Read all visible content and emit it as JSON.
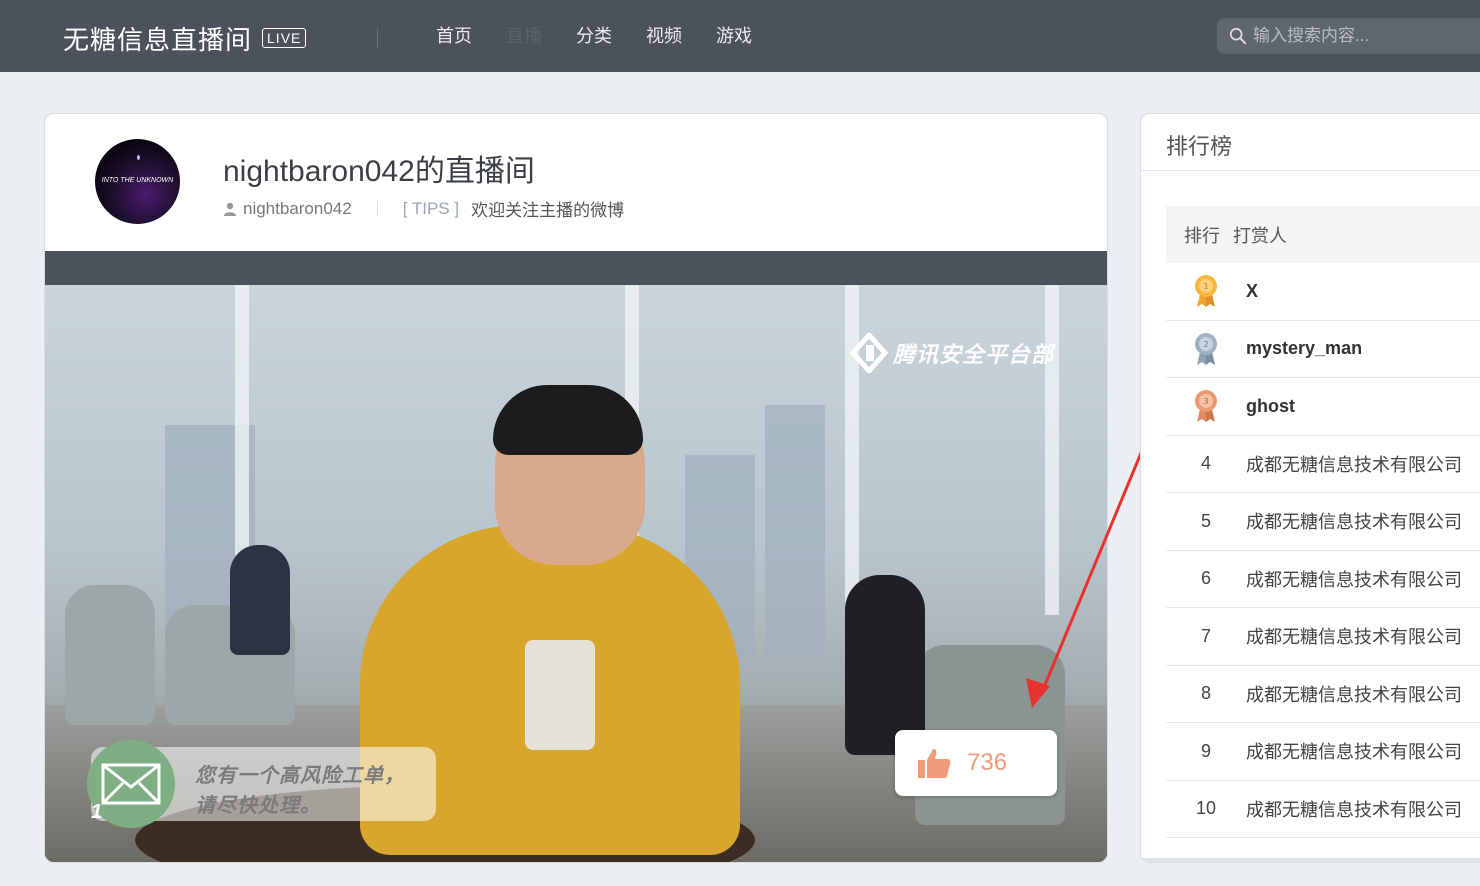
{
  "header": {
    "brand_title": "无糖信息直播间",
    "live_badge": "LIVE",
    "nav": [
      "首页",
      "直播",
      "分类",
      "视频",
      "游戏"
    ],
    "search_placeholder": "输入搜索内容..."
  },
  "room": {
    "title": "nightbaron042的直播间",
    "streamer": "nightbaron042",
    "tips_tag": "[ TIPS ]",
    "tips_text": "欢迎关注主播的微博",
    "avatar_text": "INTO THE UNKNOWN",
    "watermark": "腾讯安全平台部",
    "notice_count": "1",
    "notice_line1": "您有一个高风险工单，",
    "notice_line2": "请尽快处理。",
    "like_count": "736"
  },
  "rank": {
    "title": "排行榜",
    "col_rank": "排行",
    "col_user": "打赏人",
    "rows": [
      {
        "rank": "1",
        "name": "X",
        "medal": "gold"
      },
      {
        "rank": "2",
        "name": "mystery_man",
        "medal": "silver"
      },
      {
        "rank": "3",
        "name": "ghost",
        "medal": "bronze"
      },
      {
        "rank": "4",
        "name": "成都无糖信息技术有限公司"
      },
      {
        "rank": "5",
        "name": "成都无糖信息技术有限公司"
      },
      {
        "rank": "6",
        "name": "成都无糖信息技术有限公司"
      },
      {
        "rank": "7",
        "name": "成都无糖信息技术有限公司"
      },
      {
        "rank": "8",
        "name": "成都无糖信息技术有限公司"
      },
      {
        "rank": "9",
        "name": "成都无糖信息技术有限公司"
      },
      {
        "rank": "10",
        "name": "成都无糖信息技术有限公司"
      }
    ]
  },
  "colors": {
    "header_bg": "#4b525c",
    "like_accent": "#f09a79",
    "gold": "#f0a531",
    "silver": "#8fa1b3",
    "bronze": "#e08a5e",
    "arrow": "#e8322d"
  }
}
